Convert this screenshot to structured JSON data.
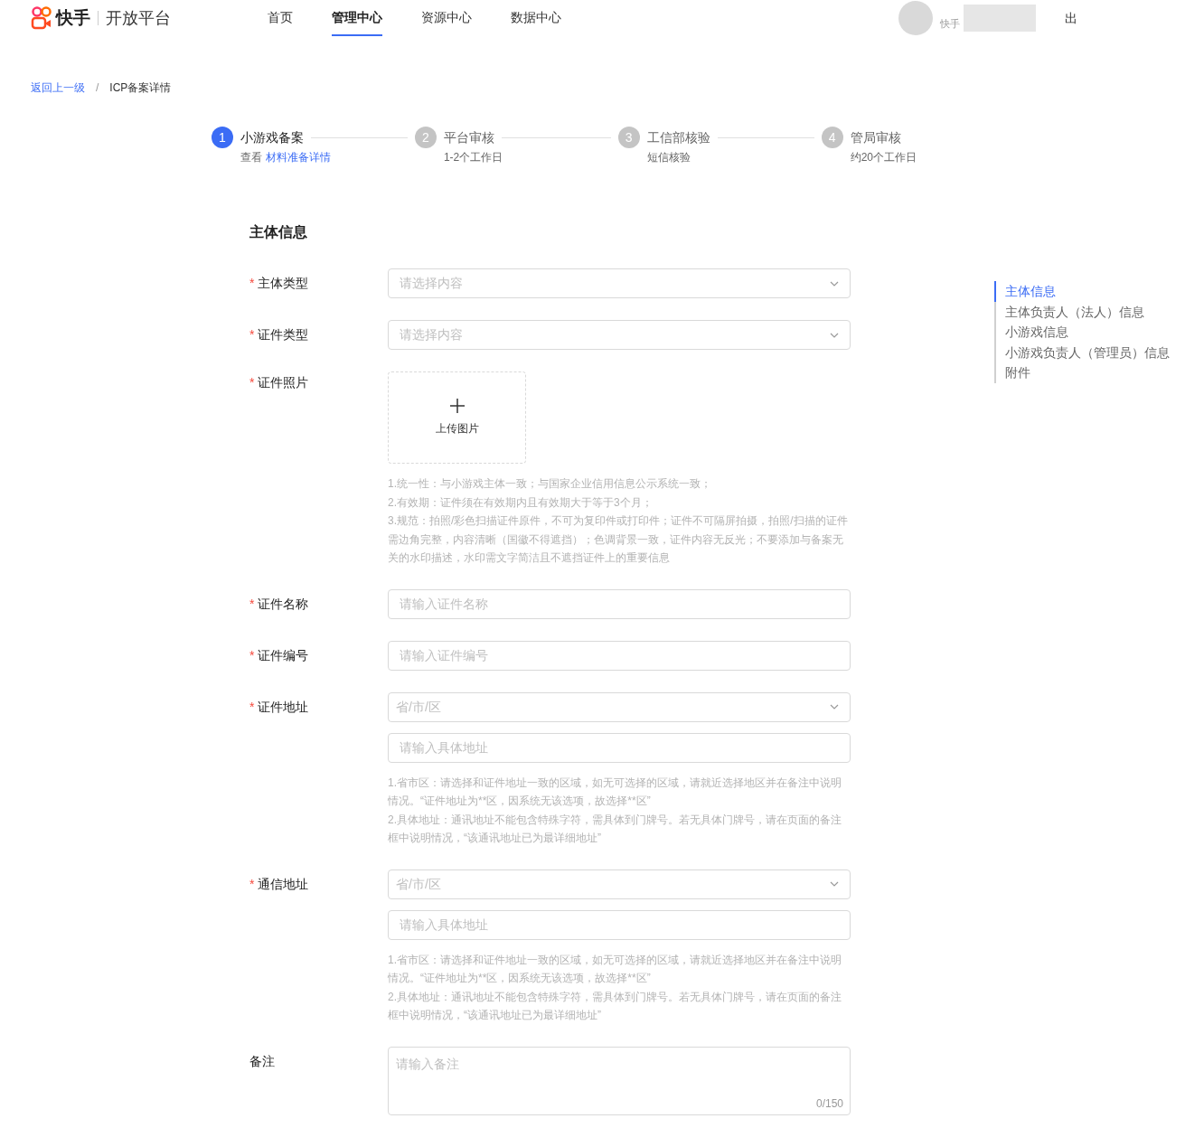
{
  "header": {
    "logo_text": "快手",
    "logo_subtitle": "开放平台",
    "nav": [
      {
        "label": "首页",
        "selected": false
      },
      {
        "label": "管理中心",
        "selected": true
      },
      {
        "label": "资源中心",
        "selected": false
      },
      {
        "label": "数据中心",
        "selected": false
      }
    ],
    "user_name": "快手",
    "logout": "出"
  },
  "breadcrumb": {
    "back": "返回上一级",
    "separator": "/",
    "current": "ICP备案详情"
  },
  "required_mark": "*",
  "steps": [
    {
      "number": "1",
      "title": "小游戏备案",
      "subtitle": "查看",
      "link": "材料准备详情",
      "selected": true
    },
    {
      "number": "2",
      "title": "平台审核",
      "subtitle": "1-2个工作日",
      "selected": false
    },
    {
      "number": "3",
      "title": "工信部核验",
      "subtitle": "短信核验",
      "selected": false
    },
    {
      "number": "4",
      "title": "管局审核",
      "subtitle": "约20个工作日",
      "selected": false
    }
  ],
  "section_title": "主体信息",
  "fields": [
    {
      "kind": "select",
      "label": "主体类型",
      "required": true,
      "placeholder": "请选择内容"
    },
    {
      "kind": "select",
      "label": "证件类型",
      "required": true,
      "placeholder": "请选择内容"
    },
    {
      "kind": "upload",
      "label": "证件照片",
      "required": true,
      "upload_label": "上传图片",
      "hints": [
        "1.统一性：与小游戏主体一致；与国家企业信用信息公示系统一致；",
        "2.有效期：证件须在有效期内且有效期大于等于3个月；",
        "3.规范：拍照/彩色扫描证件原件，不可为复印件或打印件；证件不可隔屏拍摄，拍照/扫描的证件需边角完整，内容清晰（国徽不得遮挡）；色调背景一致，证件内容无反光；不要添加与备案无关的水印描述，水印需文字简洁且不遮挡证件上的重要信息"
      ]
    },
    {
      "kind": "input",
      "label": "证件名称",
      "required": true,
      "placeholder": "请输入证件名称"
    },
    {
      "kind": "input",
      "label": "证件编号",
      "required": true,
      "placeholder": "请输入证件编号"
    },
    {
      "kind": "address",
      "label": "证件地址",
      "required": true,
      "region_placeholder": "省/市/区",
      "placeholder": "请输入具体地址",
      "hints": [
        "1.省市区：请选择和证件地址一致的区域，如无可选择的区域，请就近选择地区并在备注中说明情况。“证件地址为**区，因系统无该选项，故选择**区”",
        "2.具体地址：通讯地址不能包含特殊字符，需具体到门牌号。若无具体门牌号，请在页面的备注框中说明情况，“该通讯地址已为最详细地址”"
      ]
    },
    {
      "kind": "address",
      "label": "通信地址",
      "required": true,
      "region_placeholder": "省/市/区",
      "placeholder": "请输入具体地址",
      "hints": [
        "1.省市区：请选择和证件地址一致的区域，如无可选择的区域，请就近选择地区并在备注中说明情况。“证件地址为**区，因系统无该选项，故选择**区”",
        "2.具体地址：通讯地址不能包含特殊字符，需具体到门牌号。若无具体门牌号，请在页面的备注框中说明情况，“该通讯地址已为最详细地址”"
      ]
    },
    {
      "kind": "textarea",
      "label": "备注",
      "required": false,
      "placeholder": "请输入备注",
      "counter": "0/150"
    }
  ],
  "anchor_nav": [
    {
      "label": "主体信息",
      "selected": true
    },
    {
      "label": "主体负责人（法人）信息",
      "selected": false
    },
    {
      "label": "小游戏信息",
      "selected": false
    },
    {
      "label": "小游戏负责人（管理员）信息",
      "selected": false
    },
    {
      "label": "附件",
      "selected": false
    }
  ]
}
